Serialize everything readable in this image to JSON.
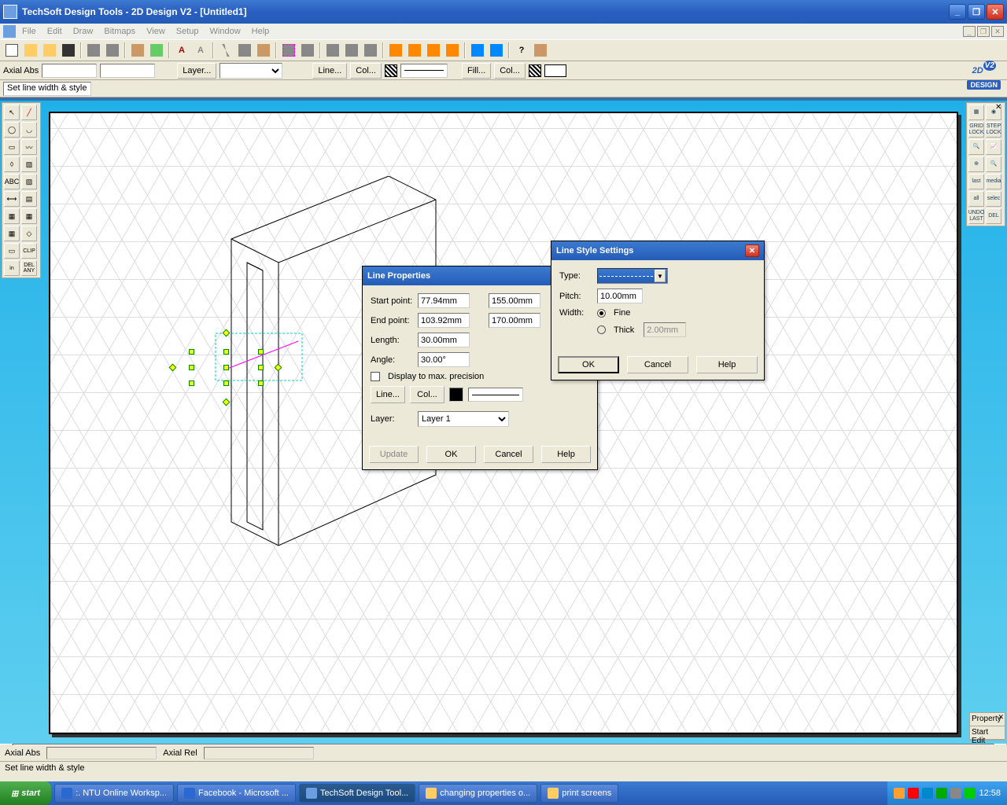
{
  "titlebar": {
    "title": "TechSoft Design Tools - 2D Design V2 - [Untitled1]"
  },
  "menus": [
    "File",
    "Edit",
    "Draw",
    "Bitmaps",
    "View",
    "Setup",
    "Window",
    "Help"
  ],
  "propbar": {
    "axial_label": "Axial Abs",
    "layer_btn": "Layer...",
    "line_btn": "Line...",
    "col_btn": "Col...",
    "fill_btn": "Fill...",
    "col2_btn": "Col..."
  },
  "status_hint": "Set line width & style",
  "logo": {
    "text": "2D",
    "sub": "DESIGN",
    "v": "V2"
  },
  "rightTools": [
    "",
    "",
    "GRID LOCK",
    "STEP LOCK",
    "",
    "",
    "",
    "",
    "last",
    "media",
    "all",
    "selec",
    "UNDO LAST",
    "DEL"
  ],
  "leftToolsBottom": {
    "abc": "ABC",
    "in": "in",
    "del_any": "DEL ANY",
    "clip": "CLIP"
  },
  "lineProps": {
    "title": "Line Properties",
    "labels": {
      "start": "Start point:",
      "end": "End point:",
      "length": "Length:",
      "angle": "Angle:",
      "display": "Display to max. precision",
      "layer": "Layer:"
    },
    "start_x": "77.94mm",
    "start_y": "155.00mm",
    "end_x": "103.92mm",
    "end_y": "170.00mm",
    "length": "30.00mm",
    "angle": "30.00°",
    "line_btn": "Line...",
    "col_btn": "Col...",
    "layer": "Layer 1",
    "buttons": {
      "update": "Update",
      "ok": "OK",
      "cancel": "Cancel",
      "help": "Help"
    }
  },
  "lineStyle": {
    "title": "Line Style Settings",
    "labels": {
      "type": "Type:",
      "pitch": "Pitch:",
      "width": "Width:",
      "fine": "Fine",
      "thick": "Thick"
    },
    "pitch": "10.00mm",
    "thick_val": "2.00mm",
    "buttons": {
      "ok": "OK",
      "cancel": "Cancel",
      "help": "Help"
    }
  },
  "docked": {
    "property": "Property",
    "startedit": "Start Edit"
  },
  "bottomStatus": {
    "axial_abs": "Axial Abs",
    "axial_rel": "Axial Rel",
    "hint": "Set line width & style"
  },
  "taskbar": {
    "start": "start",
    "tasks": [
      ":. NTU Online Worksp...",
      "Facebook - Microsoft ...",
      "TechSoft Design Tool...",
      "changing properties o...",
      "print screens"
    ],
    "active": 2,
    "clock": "12:58"
  }
}
